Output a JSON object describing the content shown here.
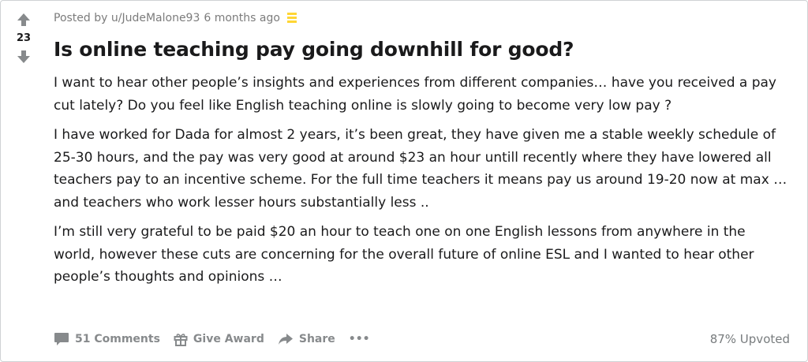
{
  "post": {
    "score": "23",
    "author_line": "Posted by u/JudeMalone93",
    "time_ago": "6 months ago",
    "title": "Is online teaching pay going downhill for good?",
    "paragraphs": [
      "I want to hear other people’s insights and experiences from different companies… have you received a pay cut lately? Do you feel like English teaching online is slowly going to become very low pay ?",
      "I have worked for Dada for almost 2 years, it’s been great, they have given me a stable weekly schedule of 25-30 hours, and the pay was very good at around $23 an hour untill recently where they have lowered all teachers pay to an incentive scheme. For the full time teachers it means pay us around 19-20 now at max … and teachers who work lesser hours substantially less ..",
      "I’m still very grateful to be paid $20 an hour to teach one on one English lessons from anywhere in the world, however these cuts are concerning for the overall future of online ESL and I wanted to hear other people’s thoughts and opinions …"
    ],
    "footer": {
      "comments_label": "51 Comments",
      "award_label": "Give Award",
      "share_label": "Share",
      "more_label": "•••",
      "upvoted_label": "87% Upvoted"
    }
  },
  "icons": {
    "upvote": "upvote-arrow-icon",
    "downvote": "downvote-arrow-icon",
    "pinned": "saved-bookmark-icon",
    "comments": "comment-bubble-icon",
    "award": "gift-icon",
    "share": "share-arrow-icon",
    "more": "more-dots-icon"
  },
  "colors": {
    "text": "#1a1a1b",
    "meta": "#7c7c7c",
    "icon_gray": "#878a8c",
    "pin_yellow": "#ffd635"
  }
}
